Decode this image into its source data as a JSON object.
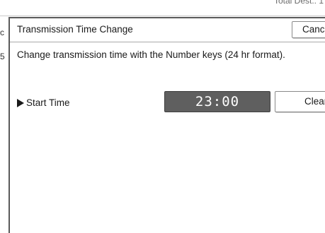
{
  "background": {
    "status_text": "Total Dest.: 1",
    "left_fragment_top": "c",
    "left_fragment_bottom": "5"
  },
  "dialog": {
    "title": "Transmission Time Change",
    "cancel_label": "Cancel",
    "instruction": "Change transmission time with the Number keys (24 hr format).",
    "start_time": {
      "label": "Start Time",
      "icon": "right-triangle-icon",
      "hours": "23",
      "separator": ":",
      "minutes": "00",
      "clear_label": "Clear"
    }
  },
  "colors": {
    "time_display_bg": "#5f5f5f",
    "time_display_text": "#ffffff"
  }
}
